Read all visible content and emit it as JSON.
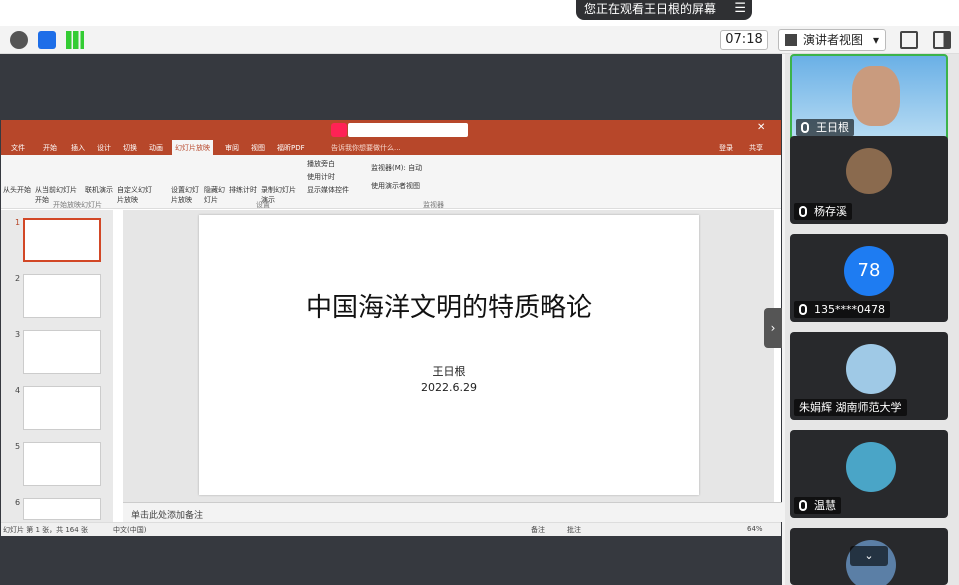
{
  "banner": {
    "sharing_text": "您正在观看王日根的屏幕",
    "menu_glyph": "☰"
  },
  "toolbar": {
    "timer": "07:18",
    "view_mode": "演讲者视图",
    "dropdown_glyph": "▾"
  },
  "ppt": {
    "menus": [
      "文件",
      "开始",
      "插入",
      "设计",
      "切换",
      "动画",
      "幻灯片放映",
      "审阅",
      "视图",
      "福昕PDF"
    ],
    "active_menu": "幻灯片放映",
    "search_hint": "告诉我你想要做什么...",
    "login": "登录",
    "share": "共享",
    "ribbon_buttons": [
      "从头开始",
      "从当前幻灯片开始",
      "联机演示",
      "自定义幻灯片放映",
      "设置幻灯片放映",
      "隐藏幻灯片",
      "排练计时",
      "录制幻灯片演示"
    ],
    "ribbon_checks": [
      "播放旁白",
      "使用计时",
      "显示媒体控件",
      "使用演示者视图"
    ],
    "monitor_label": "监视器(M): 自动",
    "group_labels": [
      "开始放映幻灯片",
      "设置",
      "监视器"
    ],
    "slide_numbers": [
      "1",
      "2",
      "3",
      "4",
      "5",
      "6"
    ],
    "slide": {
      "title": "中国海洋文明的特质略论",
      "author": "王日根",
      "date": "2022.6.29"
    },
    "notes_placeholder": "单击此处添加备注",
    "status": {
      "slide_count": "幻灯片 第 1 张，共 164 张",
      "language": "中文(中国)",
      "notes_btn": "备注",
      "comments_btn": "批注",
      "zoom": "64%"
    }
  },
  "participants": [
    {
      "name": "王日根",
      "type": "video"
    },
    {
      "name": "杨存溪",
      "type": "avatar"
    },
    {
      "name": "135****0478",
      "type": "initials",
      "initials": "78",
      "color": "#1e7cf2"
    },
    {
      "name": "朱娟辉 湖南师范大学",
      "type": "avatar"
    },
    {
      "name": "温慧",
      "type": "avatar"
    },
    {
      "name": "",
      "type": "avatar"
    }
  ]
}
